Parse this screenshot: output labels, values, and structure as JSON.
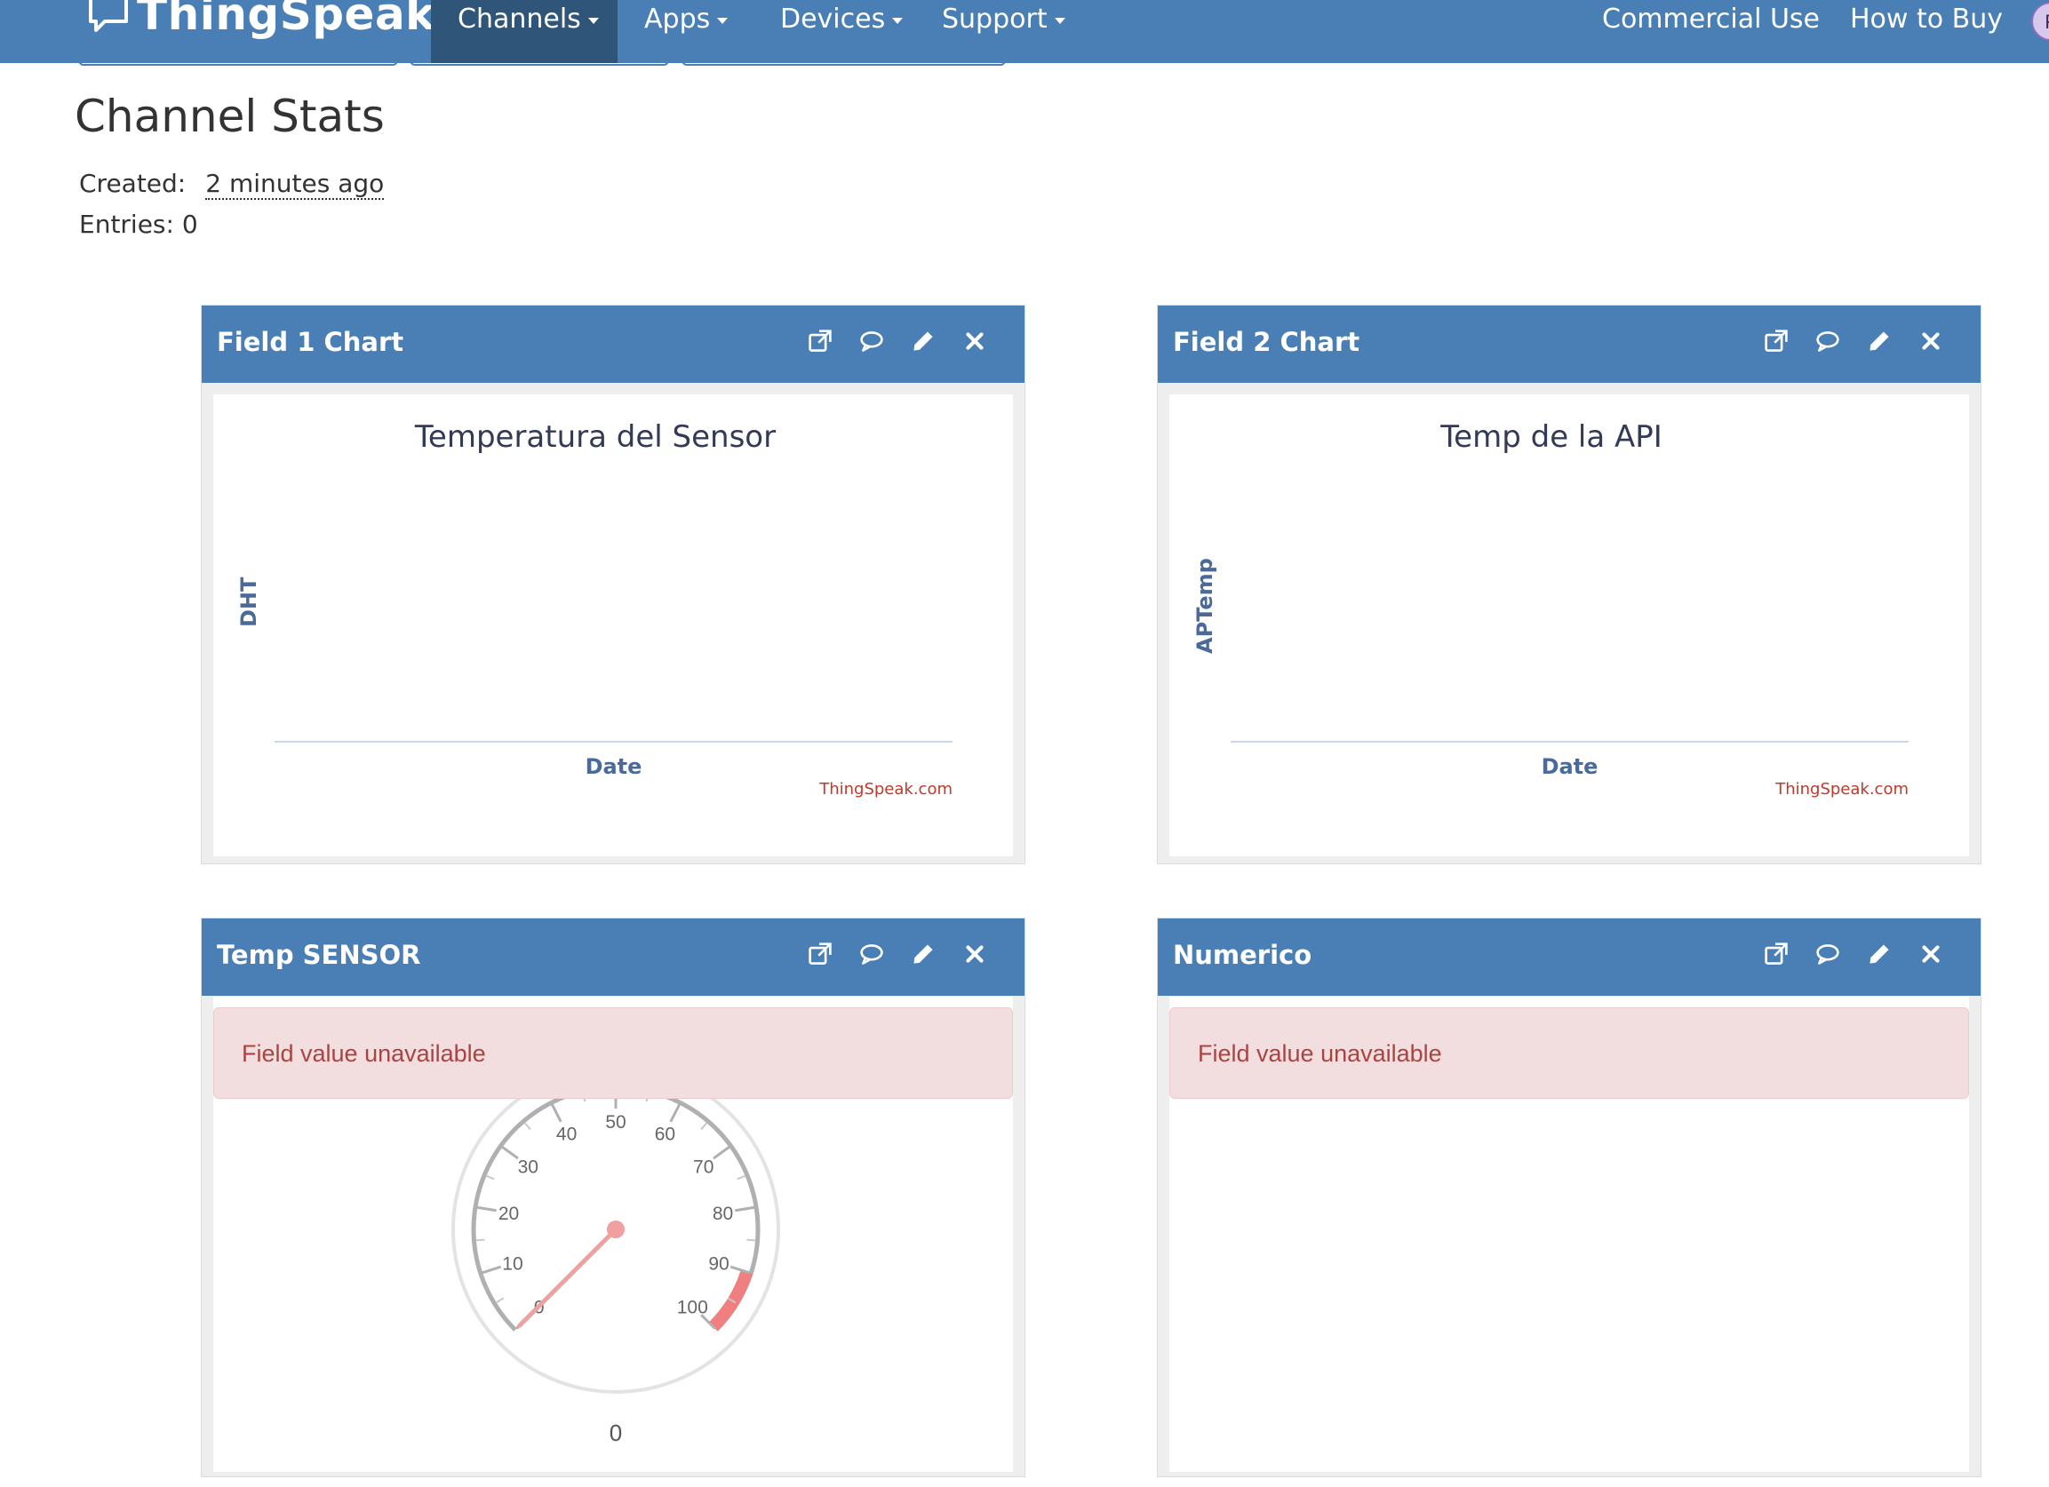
{
  "navbar": {
    "brand": "ThingSpeak",
    "trademark": "™",
    "menu": [
      {
        "label": "Channels"
      },
      {
        "label": "Apps"
      },
      {
        "label": "Devices"
      },
      {
        "label": "Support"
      }
    ],
    "right_links": [
      {
        "label": "Commercial Use"
      },
      {
        "label": "How to Buy"
      }
    ],
    "avatar_initial": "F"
  },
  "stats": {
    "title": "Channel Stats",
    "created_label": "Created:",
    "created_value": "2 minutes ago",
    "entries_label": "Entries:",
    "entries_value": "0"
  },
  "widgets": [
    {
      "title": "Field 1 Chart",
      "chart": {
        "title": "Temperatura del Sensor",
        "ylabel": "DHT",
        "xlabel": "Date",
        "credit": "ThingSpeak.com"
      }
    },
    {
      "title": "Field 2 Chart",
      "chart": {
        "title": "Temp de la API",
        "ylabel": "APTemp",
        "xlabel": "Date",
        "credit": "ThingSpeak.com"
      }
    },
    {
      "title": "Temp SENSOR",
      "alert": "Field value unavailable",
      "gauge": {
        "min": 0,
        "max": 100,
        "value": 0,
        "value_label": "0",
        "ticks": [
          "0",
          "10",
          "20",
          "30",
          "40",
          "50",
          "60",
          "70",
          "80",
          "90",
          "100"
        ],
        "danger_from": 90,
        "danger_to": 100
      }
    },
    {
      "title": "Numerico",
      "alert": "Field value unavailable"
    }
  ],
  "tool_icons": [
    "external-link-icon",
    "comment-icon",
    "pencil-icon",
    "close-icon"
  ],
  "colors": {
    "navbar": "#4a7fb5",
    "navbar_active": "#2f5678",
    "alert_bg": "#f2dede",
    "alert_text": "#a94442",
    "gauge_needle": "#f0a0a0",
    "gauge_band": "#f08080"
  }
}
